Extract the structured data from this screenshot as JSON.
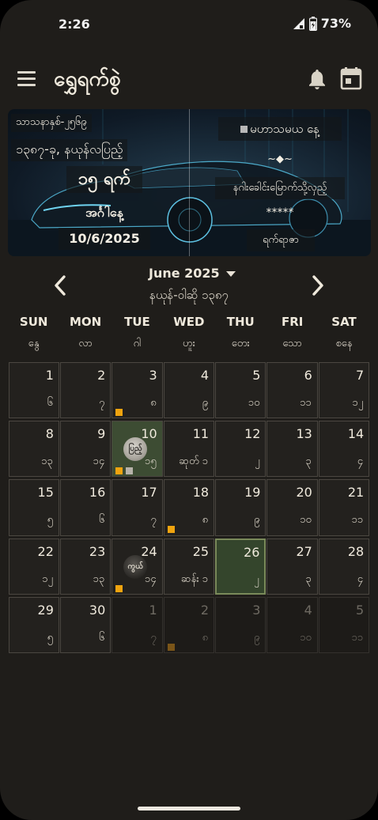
{
  "status_bar": {
    "time": "2:26",
    "battery": "73%"
  },
  "app": {
    "title": "ရွှေရက်စွဲ"
  },
  "banner": {
    "era": "သာသနာနှစ်-၂၅၆၉",
    "myanmar_year_month": "၁၃၈၇-ခု, နယုန်လပြည့်",
    "day": "၁၅ ရက်",
    "weekday": "အင်္ဂါနေ့",
    "gregorian_date": "10/6/2025",
    "mahathamaya": "မဟာသမယ နေ့",
    "symbol": "~◆~",
    "nagar": "နဂါးခေါင်းမြောက်သို့လှည့်",
    "stars": "*****",
    "yatyaza": "ရက်ရာဇာ"
  },
  "month_nav": {
    "title": "June 2025",
    "myanmar_month": "နယုန်-ဝါဆို ၁၃၈၇"
  },
  "weekdays": [
    {
      "en": "SUN",
      "mm": "နွေ"
    },
    {
      "en": "MON",
      "mm": "လာ"
    },
    {
      "en": "TUE",
      "mm": "ဂါ"
    },
    {
      "en": "WED",
      "mm": "ဟူး"
    },
    {
      "en": "THU",
      "mm": "တေး"
    },
    {
      "en": "FRI",
      "mm": "သော"
    },
    {
      "en": "SAT",
      "mm": "စနေ"
    }
  ],
  "colors": {
    "accent_dot": "#f0a40f",
    "gray_dot": "#b7b3aa",
    "today_bg": "#34452c"
  },
  "calendar": [
    [
      {
        "d": "1",
        "m": "၆"
      },
      {
        "d": "2",
        "m": "၇"
      },
      {
        "d": "3",
        "m": "၈",
        "dots": [
          "o"
        ]
      },
      {
        "d": "4",
        "m": "၉"
      },
      {
        "d": "5",
        "m": "၁၀"
      },
      {
        "d": "6",
        "m": "၁၁"
      },
      {
        "d": "7",
        "m": "၁၂"
      }
    ],
    [
      {
        "d": "8",
        "m": "၁၃"
      },
      {
        "d": "9",
        "m": "၁၄"
      },
      {
        "d": "10",
        "m": "၁၅",
        "dots": [
          "o",
          "g"
        ],
        "moon": "full",
        "moon_label": "ပြည့်",
        "selected": true
      },
      {
        "d": "11",
        "m": "ဆုတ် ၁"
      },
      {
        "d": "12",
        "m": "၂"
      },
      {
        "d": "13",
        "m": "၃"
      },
      {
        "d": "14",
        "m": "၄"
      }
    ],
    [
      {
        "d": "15",
        "m": "၅"
      },
      {
        "d": "16",
        "m": "၆"
      },
      {
        "d": "17",
        "m": "၇"
      },
      {
        "d": "18",
        "m": "၈",
        "dots": [
          "o"
        ]
      },
      {
        "d": "19",
        "m": "၉"
      },
      {
        "d": "20",
        "m": "၁၀"
      },
      {
        "d": "21",
        "m": "၁၁"
      }
    ],
    [
      {
        "d": "22",
        "m": "၁၂"
      },
      {
        "d": "23",
        "m": "၁၃"
      },
      {
        "d": "24",
        "m": "၁၄",
        "dots": [
          "o"
        ],
        "moon": "new",
        "moon_label": "ကွယ်"
      },
      {
        "d": "25",
        "m": "ဆန်း ၁"
      },
      {
        "d": "26",
        "m": "၂",
        "today": true
      },
      {
        "d": "27",
        "m": "၃"
      },
      {
        "d": "28",
        "m": "၄"
      }
    ],
    [
      {
        "d": "29",
        "m": "၅"
      },
      {
        "d": "30",
        "m": "၆"
      },
      {
        "d": "1",
        "m": "၇",
        "dim": true
      },
      {
        "d": "2",
        "m": "၈",
        "dim": true,
        "dots": [
          "o"
        ]
      },
      {
        "d": "3",
        "m": "၉",
        "dim": true
      },
      {
        "d": "4",
        "m": "၁၀",
        "dim": true
      },
      {
        "d": "5",
        "m": "၁၁",
        "dim": true
      }
    ]
  ]
}
